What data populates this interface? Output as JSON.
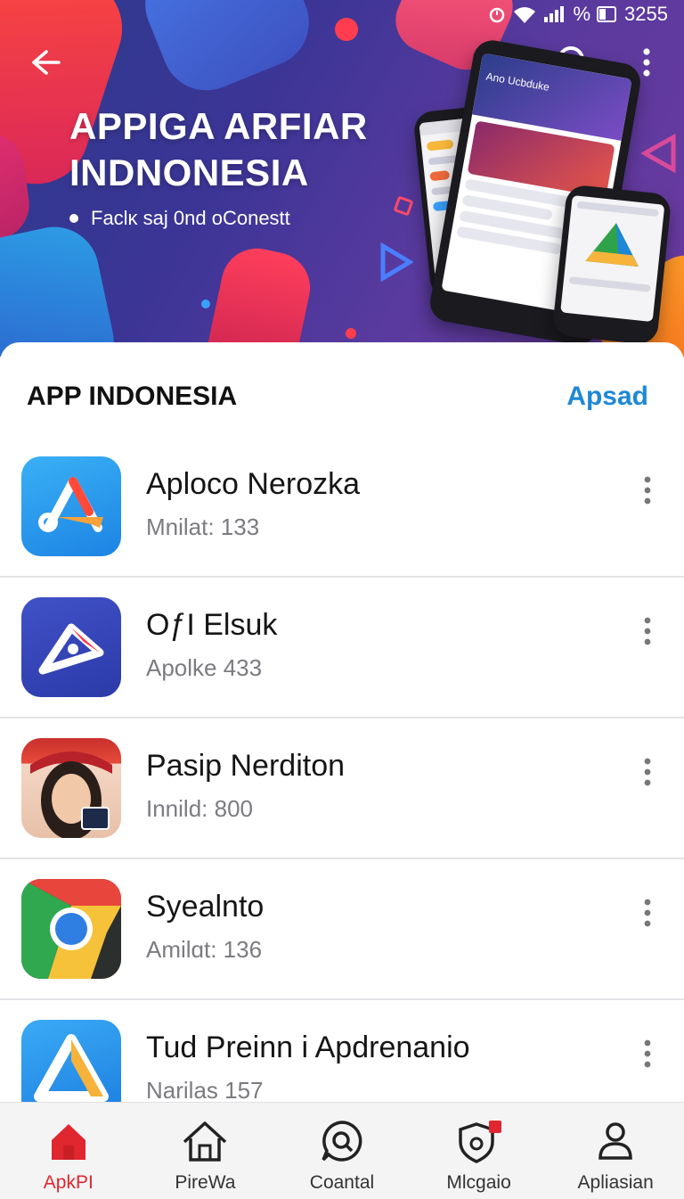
{
  "status_bar": {
    "time": "3255",
    "battery_label": "%"
  },
  "hero": {
    "title_line1": "APPIGA ARFIAR",
    "title_line2": "INDNONESIA",
    "subtitle": "Faclĸ saj 0nd oConestt",
    "phone_screen_title": "Ano Ucbduke"
  },
  "section": {
    "title": "APP INDONESIA",
    "action_label": "Apsad"
  },
  "apps": [
    {
      "name": "Aploco Nerozka",
      "meta": "Mnilat:  133",
      "icon": "a-logo-blue-icon"
    },
    {
      "name": "OƒI Elsuk",
      "meta": "Apolke  433",
      "icon": "play-arrow-indigo-icon"
    },
    {
      "name": "Pasip Nerditon",
      "meta": "Innild:  800",
      "icon": "portrait-photo-icon"
    },
    {
      "name": "Syealnto",
      "meta": "Amilɑt:  136",
      "icon": "chrome-like-icon"
    },
    {
      "name": "Tud Preinn i Apdrenanio",
      "meta": "Narilas  157",
      "icon": "triangle-logo-icon"
    }
  ],
  "bottom_nav": [
    {
      "label": "ApkPI",
      "icon": "home-filled-icon",
      "active": true
    },
    {
      "label": "PireWa",
      "icon": "home-outline-icon",
      "active": false
    },
    {
      "label": "Coantal",
      "icon": "chat-search-icon",
      "active": false
    },
    {
      "label": "Mlcgaio",
      "icon": "shield-badge-icon",
      "active": false
    },
    {
      "label": "Apliasian",
      "icon": "person-icon",
      "active": false
    }
  ],
  "colors": {
    "accent": "#1e88d6",
    "active_nav": "#e0262e",
    "hero_bg": "#3b3596"
  }
}
